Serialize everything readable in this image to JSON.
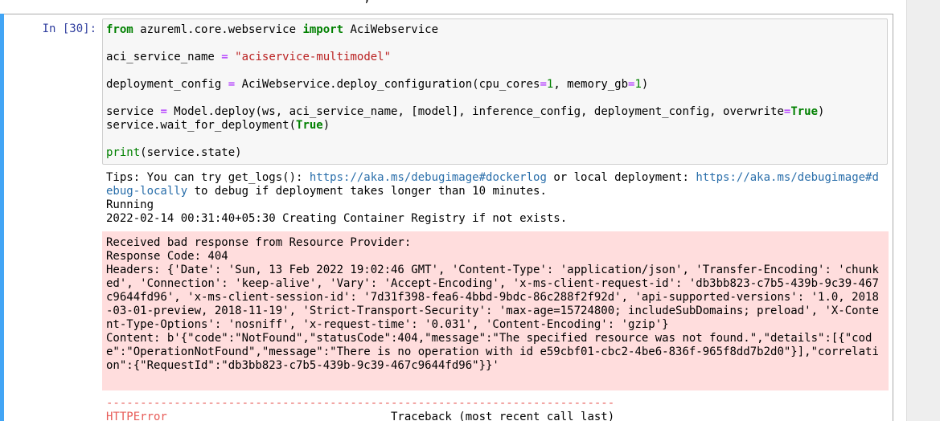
{
  "prev_cell_fragment": "                                      ,",
  "cell": {
    "prompt": "In [30]:",
    "code": {
      "line1": {
        "kw_from": "from",
        "module": " azureml.core.webservice ",
        "kw_import": "import",
        "name": " AciWebservice"
      },
      "line2": {
        "var": "aci_service_name ",
        "op": "=",
        "sp": " ",
        "str": "\"aciservice-multimodel\""
      },
      "line3": {
        "var": "deployment_config ",
        "op": "=",
        "call": " AciWebservice.deploy_configuration(cpu_cores",
        "op2": "=",
        "num1": "1",
        "mid": ", memory_gb",
        "op3": "=",
        "num2": "1",
        "end": ")"
      },
      "line4": {
        "var": "service ",
        "op": "=",
        "call": " Model.deploy(ws, aci_service_name, [model], inference_config, deployment_config, overwrite",
        "op2": "=",
        "kw_true": "True",
        "end": ")"
      },
      "line5": {
        "call": "service.wait_for_deployment(",
        "kw_true": "True",
        "end": ")"
      },
      "line6": {
        "builtin": "print",
        "rest": "(service.state)"
      }
    },
    "output": {
      "tips_prefix": "Tips: You can try get_logs(): ",
      "link1": "https://aka.ms/debugimage#dockerlog",
      "tips_mid": " or local deployment: ",
      "link2_part1": "https://aka.ms/debugimage#d",
      "link2_part2": "ebug-locally",
      "tips_suffix": " to debug if deployment takes longer than 10 minutes.",
      "running": "Running",
      "creating": "2022-02-14 00:31:40+05:30 Creating Container Registry if not exists."
    },
    "stderr": {
      "lines": [
        "Received bad response from Resource Provider:",
        "Response Code: 404",
        "Headers: {'Date': 'Sun, 13 Feb 2022 19:02:46 GMT', 'Content-Type': 'application/json', 'Transfer-Encoding': 'chunk",
        "ed', 'Connection': 'keep-alive', 'Vary': 'Accept-Encoding', 'x-ms-client-request-id': 'db3bb823-c7b5-439b-9c39-467",
        "c9644fd96', 'x-ms-client-session-id': '7d31f398-fea6-4bbd-9bdc-86c288f2f92d', 'api-supported-versions': '1.0, 2018",
        "-03-01-preview, 2018-11-19', 'Strict-Transport-Security': 'max-age=15724800; includeSubDomains; preload', 'X-Conte",
        "nt-Type-Options': 'nosniff', 'x-request-time': '0.031', 'Content-Encoding': 'gzip'}",
        "Content: b'{\"code\":\"NotFound\",\"statusCode\":404,\"message\":\"The specified resource was not found.\",\"details\":[{\"cod",
        "e\":\"OperationNotFound\",\"message\":\"There is no operation with id e59cbf01-cbc2-4be6-836f-965f8dd7b2d0\"}],\"correlati",
        "on\":{\"RequestId\":\"db3bb823-c7b5-439b-9c39-467c9644fd96\"}}'"
      ]
    },
    "traceback": {
      "dashes": "---------------------------------------------------------------------------",
      "error_name": "HTTPError",
      "header": "                                 Traceback (most recent call last)"
    }
  }
}
